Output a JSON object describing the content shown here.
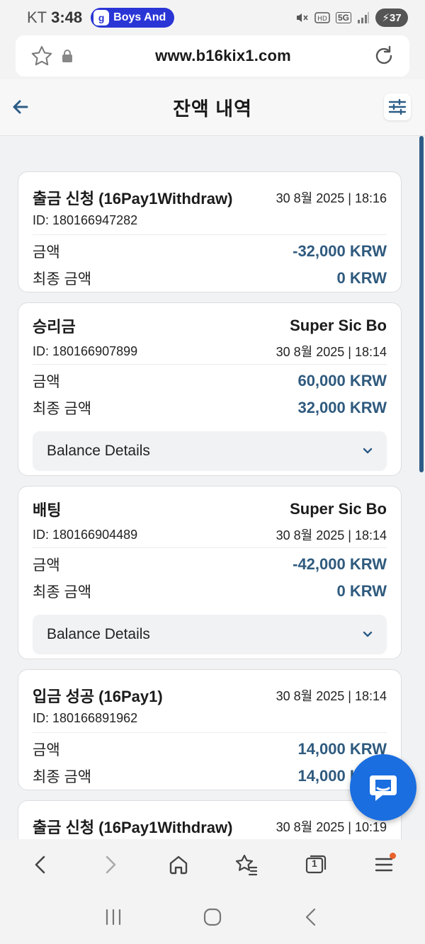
{
  "status_bar": {
    "carrier": "KT",
    "time": "3:48",
    "notification": "Boys And",
    "notification_icon": "g",
    "network": "5G",
    "battery": "37"
  },
  "browser": {
    "url": "www.b16kix1.com",
    "tab_count": "1"
  },
  "header": {
    "title": "잔액 내역"
  },
  "transactions": [
    {
      "title": "출금 신청 (16Pay1Withdraw)",
      "game": "",
      "date": "30 8월 2025 | 18:16",
      "id": "ID: 180166947282",
      "amount_label": "금액",
      "amount": "-32,000 KRW",
      "final_label": "최종 금액",
      "final_amount": "0 KRW"
    },
    {
      "title": "승리금",
      "game": "Super Sic Bo",
      "date": "30 8월 2025 | 18:14",
      "id": "ID: 180166907899",
      "amount_label": "금액",
      "amount": "60,000 KRW",
      "final_label": "최종 금액",
      "final_amount": "32,000 KRW",
      "details_label": "Balance Details"
    },
    {
      "title": "배팅",
      "game": "Super Sic Bo",
      "date": "30 8월 2025 | 18:14",
      "id": "ID: 180166904489",
      "amount_label": "금액",
      "amount": "-42,000 KRW",
      "final_label": "최종 금액",
      "final_amount": "0 KRW",
      "details_label": "Balance Details"
    },
    {
      "title": "입금 성공 (16Pay1)",
      "game": "",
      "date": "30 8월 2025 | 18:14",
      "id": "ID: 180166891962",
      "amount_label": "금액",
      "amount": "14,000 KRW",
      "final_label": "최종 금액",
      "final_amount": "14,000 KRW"
    },
    {
      "title": "출금 신청 (16Pay1Withdraw)",
      "game": "",
      "date": "30 8월 2025 | 10:19"
    }
  ],
  "colors": {
    "amount": "#2f5a7e",
    "accent": "#1a6ee0",
    "scrollbar": "#2c5c86"
  }
}
